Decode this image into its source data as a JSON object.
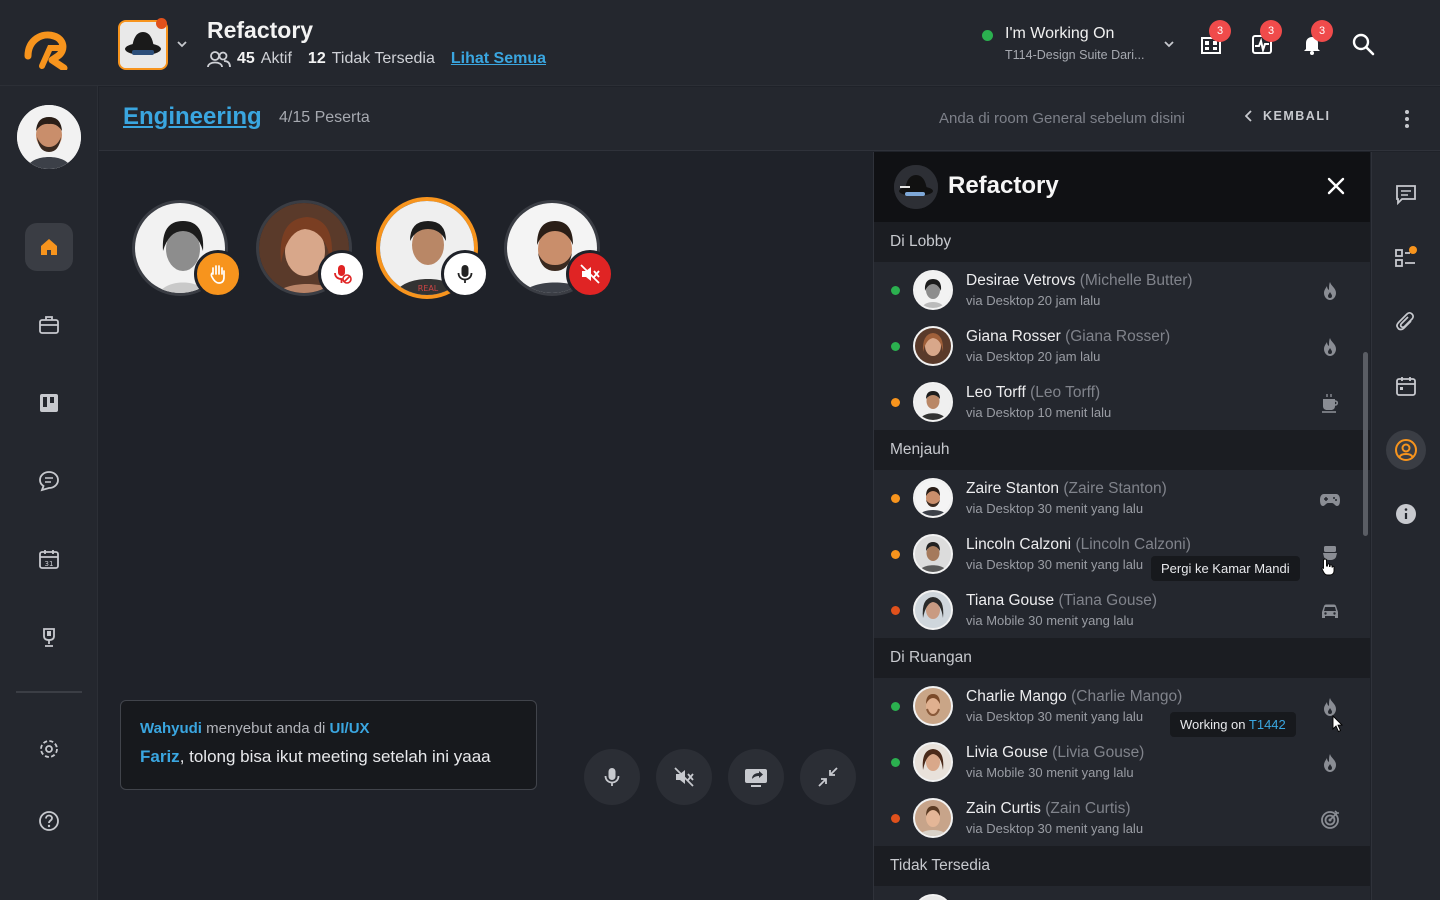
{
  "topbar": {
    "org_name": "Refactory",
    "active_count": "45",
    "active_label": "Aktif",
    "unavailable_count": "12",
    "unavailable_label": "Tidak Tersedia",
    "see_all": "Lihat Semua",
    "status_title": "I'm Working On",
    "status_task": "T114-Design Suite Dari...",
    "badges": {
      "board": "3",
      "activity": "3",
      "notifications": "3"
    }
  },
  "sidebar": {
    "items": [
      "home-icon",
      "briefcase-icon",
      "board-icon",
      "chat-icon",
      "calendar-icon",
      "trophy-icon",
      "settings-icon",
      "help-icon"
    ],
    "active": "home-icon"
  },
  "room": {
    "title": "Engineering",
    "participants": "4/15 Peserta",
    "note": "Anda di room General sebelum disini",
    "back_label": "KEMBALI"
  },
  "stage": {
    "participants": [
      {
        "badge": "hand-raised-icon",
        "badge_color": "#f7941d"
      },
      {
        "badge": "mic-off-icon",
        "badge_color": "#ffffff"
      },
      {
        "badge": "mic-icon",
        "badge_color": "#ffffff",
        "speaking": true
      },
      {
        "badge": "speaker-off-icon",
        "badge_color": "#e02424"
      }
    ],
    "toast": {
      "sender": "Wahyudi",
      "middle": " menyebut anda di ",
      "channel": "UI/UX",
      "mention": "Fariz",
      "message": ", tolong bisa ikut meeting setelah ini yaaa"
    },
    "controls": [
      "mic-icon",
      "speaker-off-icon",
      "screen-share-icon",
      "minimize-icon"
    ]
  },
  "panel": {
    "title": "Refactory",
    "groups": [
      {
        "label": "Di Lobby",
        "people": [
          {
            "name": "Desirae Vetrovs",
            "alias": "(Michelle Butter)",
            "sub": "via Desktop 20 jam lalu",
            "status": "#2bb04f",
            "icon": "fire-icon"
          },
          {
            "name": "Giana Rosser",
            "alias": "(Giana Rosser)",
            "sub": "via Desktop 20 jam lalu",
            "status": "#2bb04f",
            "icon": "fire-icon"
          },
          {
            "name": "Leo Torff",
            "alias": "(Leo Torff)",
            "sub": "via Desktop 10 menit lalu",
            "status": "#f7941d",
            "icon": "coffee-icon"
          }
        ]
      },
      {
        "label": "Menjauh",
        "people": [
          {
            "name": "Zaire Stanton",
            "alias": "(Zaire Stanton)",
            "sub": "via Desktop 30 menit yang lalu",
            "status": "#f7941d",
            "icon": "gamepad-icon"
          },
          {
            "name": "Lincoln Calzoni",
            "alias": "(Lincoln Calzoni)",
            "sub": "via Desktop 30 menit yang lalu",
            "status": "#f7941d",
            "icon": "toilet-icon"
          },
          {
            "name": "Tiana Gouse",
            "alias": "(Tiana Gouse)",
            "sub": "via Mobile 30 menit yang lalu",
            "status": "#e0511c",
            "icon": "car-icon"
          }
        ]
      },
      {
        "label": "Di Ruangan",
        "people": [
          {
            "name": "Charlie Mango",
            "alias": "(Charlie Mango)",
            "sub": "via Desktop 30 menit yang lalu",
            "status": "#2bb04f",
            "icon": "fire-icon"
          },
          {
            "name": "Livia Gouse",
            "alias": "(Livia Gouse)",
            "sub": "via Mobile 30 menit yang lalu",
            "status": "#2bb04f",
            "icon": "fire-icon"
          },
          {
            "name": "Zain Curtis",
            "alias": "(Zain Curtis)",
            "sub": "via Desktop 30 menit yang lalu",
            "status": "#e0511c",
            "icon": "target-icon"
          }
        ]
      },
      {
        "label": "Tidak Tersedia",
        "people": []
      }
    ],
    "tooltip_away": "Pergi ke Kamar Mandi",
    "tooltip_working_prefix": "Working on ",
    "tooltip_working_task": "T1442"
  },
  "rail": {
    "items": [
      "message-icon",
      "tasks-icon",
      "attachment-icon",
      "calendar-icon",
      "people-icon",
      "info-icon"
    ],
    "active": "people-icon"
  },
  "colors": {
    "accent_orange": "#f7941d",
    "accent_blue": "#3aa6e0",
    "online": "#2bb04f",
    "away": "#f7941d",
    "busy": "#e0511c",
    "badge_red": "#f04b4b"
  }
}
